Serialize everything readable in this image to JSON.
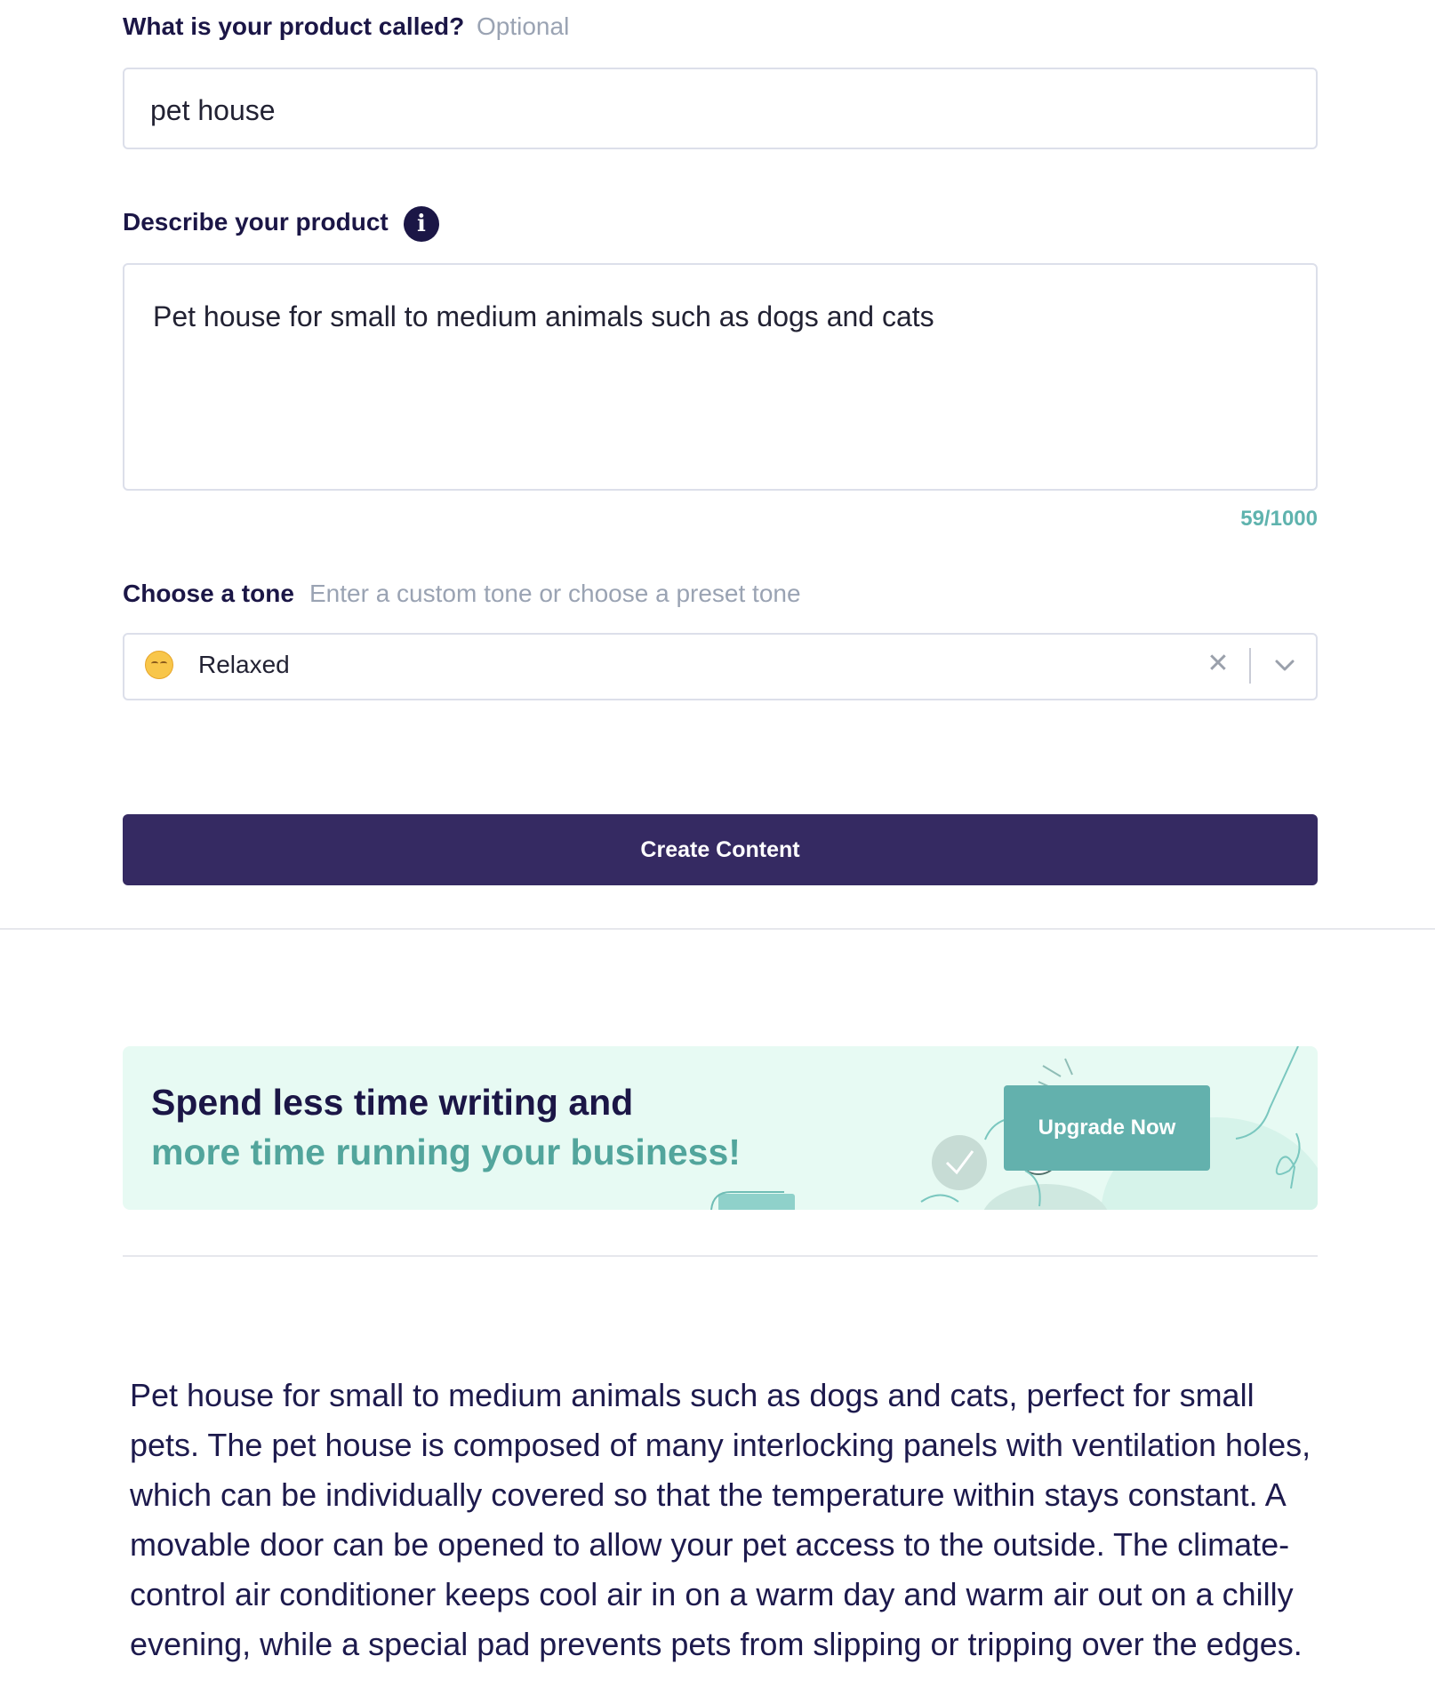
{
  "product_name": {
    "label": "What is your product called?",
    "optional_tag": "Optional",
    "value": "pet house"
  },
  "description": {
    "label": "Describe your product",
    "info_icon": "info-icon",
    "info_glyph": "i",
    "value": "Pet house for small to medium animals such as dogs and cats",
    "counter": "59/1000"
  },
  "tone": {
    "label": "Choose a tone",
    "hint": "Enter a custom tone or choose a preset tone",
    "selected_icon": "relieved-face-icon",
    "selected_value": "Relaxed",
    "clear_icon": "close-icon",
    "clear_glyph": "✕",
    "dropdown_icon": "chevron-down-icon"
  },
  "actions": {
    "create_label": "Create Content"
  },
  "banner": {
    "line1": "Spend less time writing and",
    "line2": "more time running your business!",
    "upgrade_label": "Upgrade Now",
    "colors": {
      "background": "#e7faf3",
      "accent": "#52a59c",
      "button": "#63b1ad"
    }
  },
  "output": {
    "text": "Pet house for small to medium animals such as dogs and cats, perfect for small pets. The pet house is composed of many interlocking panels with ventilation holes, which can be individually covered so that the temperature within stays constant. A movable door can be opened to allow your pet access to the outside. The climate-control air conditioner keeps cool air in on a warm day and warm air out on a chilly evening, while a special pad prevents pets from slipping or tripping over the edges."
  },
  "colors": {
    "primary": "#352a62",
    "heading": "#1b1646",
    "counter": "#5fb3ae"
  }
}
